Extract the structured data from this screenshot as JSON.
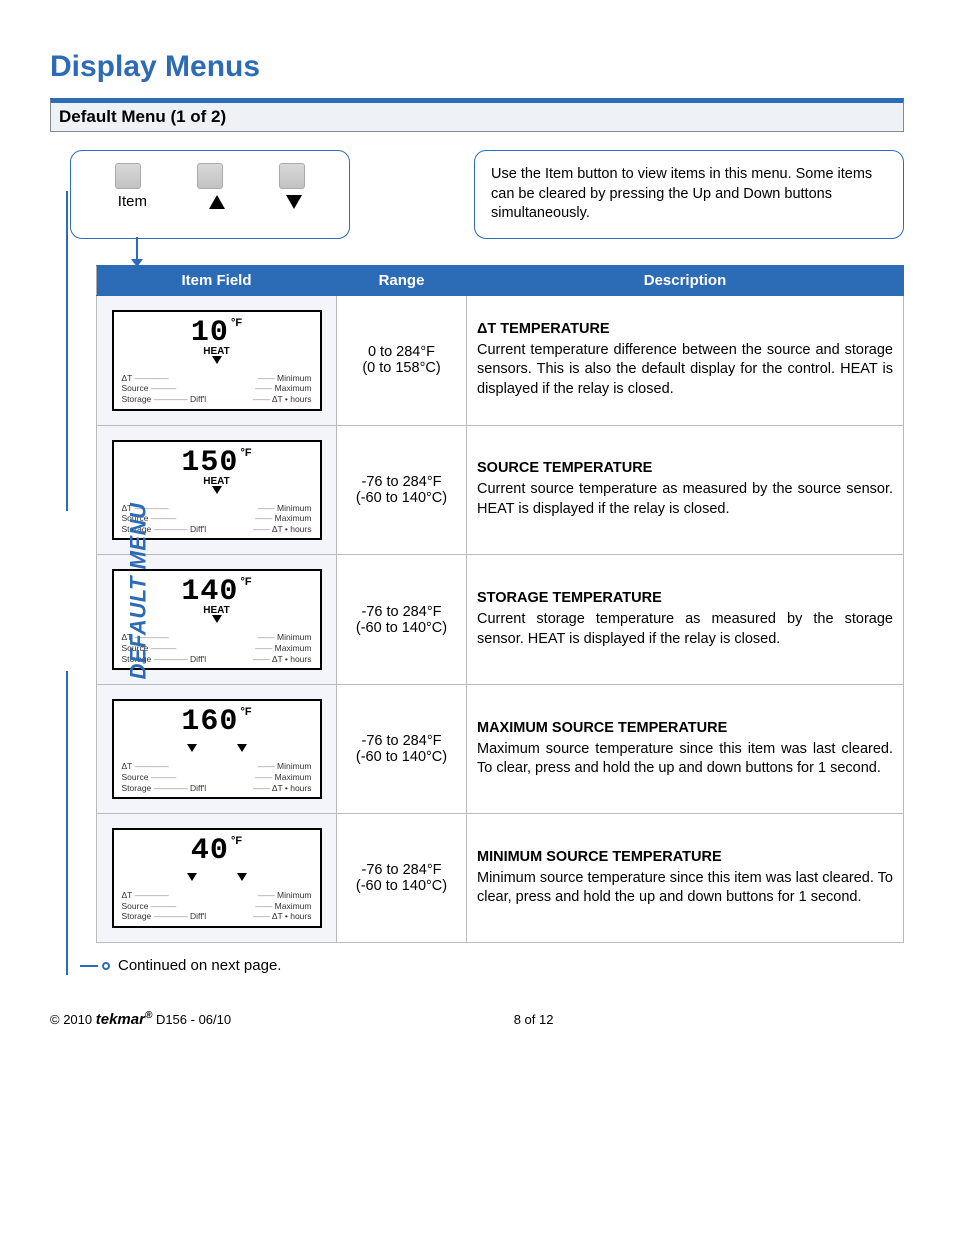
{
  "page_title": "Display Menus",
  "section_title": "Default Menu (1 of 2)",
  "button_panel": {
    "item_label": "Item"
  },
  "info_text": "Use the Item button to view items in this menu. Some items can be cleared by pressing the Up and Down buttons simultaneously.",
  "table": {
    "headers": {
      "item": "Item Field",
      "range": "Range",
      "desc": "Description"
    }
  },
  "side_label": "DEFAULT MENU",
  "rows": [
    {
      "lcd": {
        "value": "10",
        "unit": "°F",
        "heat": "HEAT",
        "arrows": "single"
      },
      "range_f": "0 to 284°F",
      "range_c": "(0 to 158°C)",
      "title": "ΔT TEMPERATURE",
      "body": "Current temperature difference between the source and storage sensors. This is also the default display for the control. HEAT is displayed if the relay is closed."
    },
    {
      "lcd": {
        "value": "150",
        "unit": "°F",
        "heat": "HEAT",
        "arrows": "single"
      },
      "range_f": "-76 to 284°F",
      "range_c": "(-60 to 140°C)",
      "title": "SOURCE TEMPERATURE",
      "body": "Current source temperature as measured by the source sensor. HEAT is displayed if the relay is closed."
    },
    {
      "lcd": {
        "value": "140",
        "unit": "°F",
        "heat": "HEAT",
        "arrows": "single"
      },
      "range_f": "-76 to 284°F",
      "range_c": "(-60 to 140°C)",
      "title": "STORAGE TEMPERATURE",
      "body": "Current storage temperature as measured by the storage sensor. HEAT is displayed if the relay is closed."
    },
    {
      "lcd": {
        "value": "160",
        "unit": "°F",
        "heat": "",
        "arrows": "double"
      },
      "range_f": "-76 to 284°F",
      "range_c": "(-60 to 140°C)",
      "title": "MAXIMUM SOURCE TEMPERATURE",
      "body": "Maximum source temperature since this item was last cleared. To clear, press and hold the up and down buttons for 1 second."
    },
    {
      "lcd": {
        "value": "40",
        "unit": "°F",
        "heat": "",
        "arrows": "double"
      },
      "range_f": "-76 to 284°F",
      "range_c": "(-60 to 140°C)",
      "title": "MINIMUM SOURCE TEMPERATURE",
      "body": "Minimum source temperature since this item was last cleared. To clear, press and hold the up and down buttons for 1 second."
    }
  ],
  "lcd_pointers": {
    "left": [
      "ΔT",
      "Source",
      "Storage"
    ],
    "right": [
      "Minimum",
      "Maximum",
      "ΔT • hours"
    ],
    "bottom_center": "Diff'l"
  },
  "continued_text": "Continued on next page.",
  "footer": {
    "copyright": "© 2010",
    "brand": "tekmar",
    "doc": " D156 - 06/10",
    "page": "8 of 12"
  }
}
